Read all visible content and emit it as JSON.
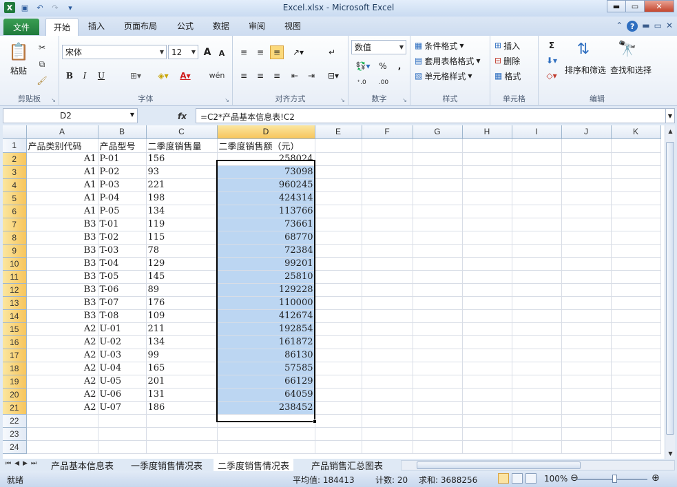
{
  "window": {
    "title": "Excel.xlsx - Microsoft Excel"
  },
  "ribbon_tabs": [
    "开始",
    "插入",
    "页面布局",
    "公式",
    "数据",
    "审阅",
    "视图"
  ],
  "file_tab": "文件",
  "ribbon": {
    "clipboard": {
      "label": "剪贴板",
      "paste": "粘贴"
    },
    "font": {
      "label": "字体",
      "name": "宋体",
      "size": "12",
      "bold": "B",
      "italic": "I",
      "underline": "U",
      "grow": "A",
      "shrink": "A",
      "wen": "wén"
    },
    "alignment": {
      "label": "对齐方式"
    },
    "number": {
      "label": "数字",
      "format": "数值",
      "percent": "%",
      "comma": ","
    },
    "styles": {
      "label": "样式",
      "conditional": "条件格式",
      "table": "套用表格格式",
      "cell": "单元格样式"
    },
    "cells": {
      "label": "单元格",
      "insert": "插入",
      "delete": "删除",
      "format": "格式"
    },
    "editing": {
      "label": "编辑",
      "sort": "排序和筛选",
      "find": "查找和选择",
      "sigma": "Σ"
    }
  },
  "formula_bar": {
    "name_box": "D2",
    "fx": "fx",
    "formula": "=C2*产品基本信息表!C2"
  },
  "columns": [
    "A",
    "B",
    "C",
    "D",
    "E",
    "F",
    "G",
    "H",
    "I",
    "J",
    "K"
  ],
  "header_row": [
    "产品类别代码",
    "产品型号",
    "二季度销售量",
    "二季度销售额（元）"
  ],
  "rows": [
    [
      "A1",
      "P-01",
      "156",
      "258024"
    ],
    [
      "A1",
      "P-02",
      "93",
      "73098"
    ],
    [
      "A1",
      "P-03",
      "221",
      "960245"
    ],
    [
      "A1",
      "P-04",
      "198",
      "424314"
    ],
    [
      "A1",
      "P-05",
      "134",
      "113766"
    ],
    [
      "B3",
      "T-01",
      "119",
      "73661"
    ],
    [
      "B3",
      "T-02",
      "115",
      "68770"
    ],
    [
      "B3",
      "T-03",
      "78",
      "72384"
    ],
    [
      "B3",
      "T-04",
      "129",
      "99201"
    ],
    [
      "B3",
      "T-05",
      "145",
      "25810"
    ],
    [
      "B3",
      "T-06",
      "89",
      "129228"
    ],
    [
      "B3",
      "T-07",
      "176",
      "110000"
    ],
    [
      "B3",
      "T-08",
      "109",
      "412674"
    ],
    [
      "A2",
      "U-01",
      "211",
      "192854"
    ],
    [
      "A2",
      "U-02",
      "134",
      "161872"
    ],
    [
      "A2",
      "U-03",
      "99",
      "86130"
    ],
    [
      "A2",
      "U-04",
      "165",
      "57585"
    ],
    [
      "A2",
      "U-05",
      "201",
      "66129"
    ],
    [
      "A2",
      "U-06",
      "131",
      "64059"
    ],
    [
      "A2",
      "U-07",
      "186",
      "238452"
    ]
  ],
  "row_numbers": [
    "1",
    "2",
    "3",
    "4",
    "5",
    "6",
    "7",
    "8",
    "9",
    "10",
    "11",
    "12",
    "13",
    "14",
    "15",
    "16",
    "17",
    "18",
    "19",
    "20",
    "21",
    "22",
    "23",
    "24"
  ],
  "sheet_tabs": [
    "产品基本信息表",
    "一季度销售情况表",
    "二季度销售情况表",
    "产品销售汇总图表"
  ],
  "status": {
    "ready": "就绪",
    "average": "平均值: 184413",
    "count": "计数: 20",
    "sum": "求和: 3688256",
    "zoom": "100%"
  }
}
